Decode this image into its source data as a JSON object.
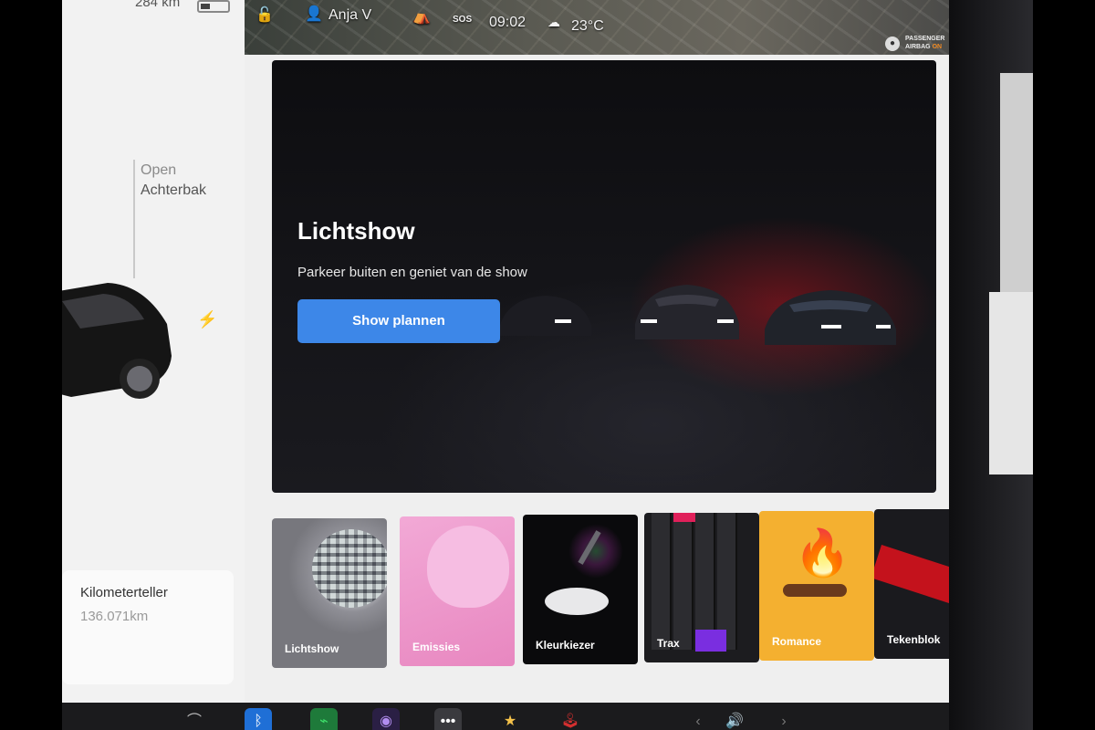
{
  "status": {
    "range": "284 km",
    "user_name": "Anja V",
    "sos": "SOS",
    "time": "09:02",
    "temperature": "23°C",
    "airbag_line1": "PASSENGER",
    "airbag_line2a": "AIRBAG",
    "airbag_line2b": "ON",
    "icons": [
      "lock-icon",
      "user-icon",
      "campfire-icon",
      "weather-icon",
      "airbag-icon"
    ]
  },
  "vehicle": {
    "trunk_state": "Open",
    "trunk_label": "Achterbak",
    "odometer_title": "Kilometerteller",
    "odometer_value": "136.071",
    "odometer_unit": "km"
  },
  "hero": {
    "title": "Lichtshow",
    "subtitle": "Parkeer buiten en geniet van de show",
    "button_label": "Show plannen",
    "button_color": "#3d87e8"
  },
  "tiles": [
    {
      "label": "Lichtshow"
    },
    {
      "label": "Emissies"
    },
    {
      "label": "Kleurkiezer"
    },
    {
      "label": "Trax"
    },
    {
      "label": "Romance"
    },
    {
      "label": "Tekenblok"
    }
  ],
  "dock": {
    "icons": [
      "wiper-icon",
      "bluetooth-icon",
      "energy-icon",
      "camera-icon",
      "more-icon",
      "toybox-icon",
      "arcade-icon",
      "prev-icon",
      "volume-icon",
      "next-icon"
    ]
  }
}
